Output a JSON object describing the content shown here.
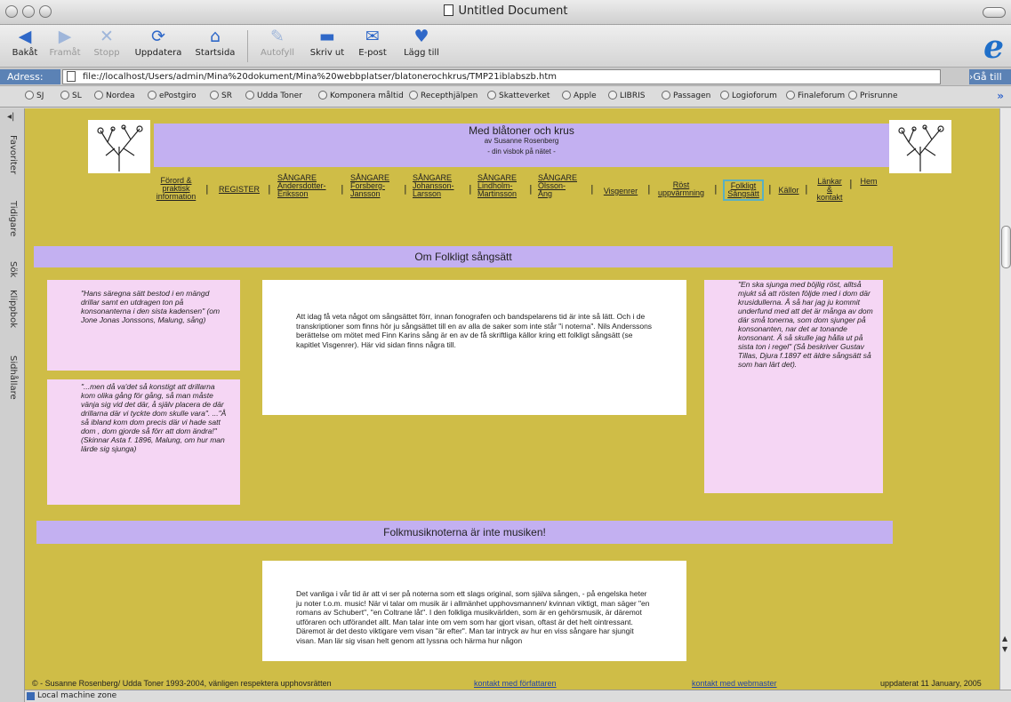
{
  "window": {
    "title": "Untitled Document"
  },
  "toolbar": {
    "back": "Bakåt",
    "forward": "Framåt",
    "stop": "Stopp",
    "refresh": "Uppdatera",
    "home": "Startsida",
    "autofill": "Autofyll",
    "print": "Skriv ut",
    "mail": "E-post",
    "add": "Lägg till"
  },
  "address": {
    "label": "Adress:",
    "url": "file://localhost/Users/admin/Mina%20dokument/Mina%20webbplatser/blatonerochkrus/TMP21iblabszb.htm",
    "go": "Gå till"
  },
  "favorites": [
    "SJ",
    "SL",
    "Nordea",
    "ePostgiro",
    "SR",
    "Udda Toner",
    "Komponera måltid",
    "Recepthjälpen",
    "Skatteverket",
    "Apple",
    "LIBRIS",
    "Passagen",
    "Logioforum",
    "Finaleforum",
    "Prisrunne"
  ],
  "sidebar_tabs": [
    "Favoriter",
    "Tidigare",
    "Sök",
    "Klippbok",
    "Sidhållare"
  ],
  "site": {
    "title": "Med blåtoner och krus",
    "author": "av Susanne Rosenberg",
    "tagline": "- din visbok på nätet -"
  },
  "nav": [
    {
      "l1": "Förord &",
      "l2": "praktisk",
      "l3": "information"
    },
    {
      "l1": "REGISTER"
    },
    {
      "l1": "SÅNGARE",
      "l2": "Andersdotter-",
      "l3": "Eriksson"
    },
    {
      "l1": "SÅNGARE",
      "l2": "Forsberg-",
      "l3": "Jansson"
    },
    {
      "l1": "SÅNGARE",
      "l2": "Johansson-",
      "l3": "Larsson"
    },
    {
      "l1": "SÅNGARE",
      "l2": "Lindholm-",
      "l3": "Martinsson"
    },
    {
      "l1": "SÅNGARE",
      "l2": "Olsson-",
      "l3": "Ång"
    },
    {
      "l1": "Visgenrer"
    },
    {
      "l1": "Röst",
      "l2": "uppvärmning"
    },
    {
      "l1": "Folkligt",
      "l2": "Sångsätt"
    },
    {
      "l1": "Källor"
    },
    {
      "l1": "Länkar",
      "l2": "&",
      "l3": "kontakt"
    },
    {
      "l1": "Hem"
    }
  ],
  "section1": {
    "heading": "Om Folkligt sångsätt",
    "quote_left_1": "\"Hans säregna sätt bestod i en mängd drillar samt en utdragen ton på konsonanterna i den sista kadensen\" (om Jone Jonas Jonssons, Malung, sång)",
    "quote_left_2": "\"...men då va'det så konstigt att drillarna kom olika gång för gång, så man måste vänja sig vid det där, å själv placera de där drillarna där vi tyckte dom skulle vara\". ...\"Å så ibland kom dom precis där vi hade satt dom , dom gjorde så förr att dom ändra!\" (Skinnar Asta f. 1896, Malung, om hur man lärde sig sjunga)",
    "body": "Att idag få veta något om sångsättet förr, innan fonografen och bandspelarens tid är inte så lätt. Och i de transkriptioner som finns hör ju sångsättet till en av alla de saker som inte står \"i noterna\". Nils Anderssons berättelse om mötet med Finn Karins sång är en av de få skriftliga källor kring ett folkligt sångsätt (se kapitlet Visgenrer). Här vid sidan finns några till.",
    "quote_right": "\"En ska sjunga med böjlig röst, alltså mjukt så att rösten följde med i dom där krusidullerna. Å så har jag ju kommit underfund med att det är många av dom där små tonerna, som dom sjunger på konsonanten, nar det ar tonande konsonant. Å så skulle jag hålla ut på sista ton i regel\" (Så beskriver Gustav Tillas, Djura f.1897 ett äldre sångsätt så som han lärt det)."
  },
  "section2": {
    "heading": "Folkmusiknoterna är inte musiken!",
    "body": "Det vanliga i vår tid är att vi ser på noterna som ett slags original, som själva sången, - på engelska heter ju noter t.o.m. music! När vi talar om musik är i allmänhet upphovsmannen/ kvinnan viktigt, man säger \"en romans av Schubert\", \"en Coltrane låt\". I den folkliga musikvärlden, som är en gehörsmusik, är däremot utföraren och utförandet allt. Man talar inte om vem som har gjort visan, oftast är det helt ointressant. Däremot är det desto viktigare vem visan \"är efter\". Man tar intryck av hur en viss sångare har sjungit visan. Man lär sig visan helt genom att lyssna och härma hur någon"
  },
  "footer": {
    "copyright": "© - Susanne Rosenberg/ Udda Toner 1993-2004, vänligen respektera upphovsrätten",
    "contact_author": "kontakt med författaren",
    "contact_webmaster": "kontakt med webmaster",
    "updated": "uppdaterat 11 January, 2005"
  },
  "status": {
    "text": "Local machine zone"
  },
  "colors": {
    "page_bg": "#cfbd47",
    "band": "#c3b0f1",
    "quote_box": "#f5d6f4",
    "accent": "#1f6fc9"
  }
}
